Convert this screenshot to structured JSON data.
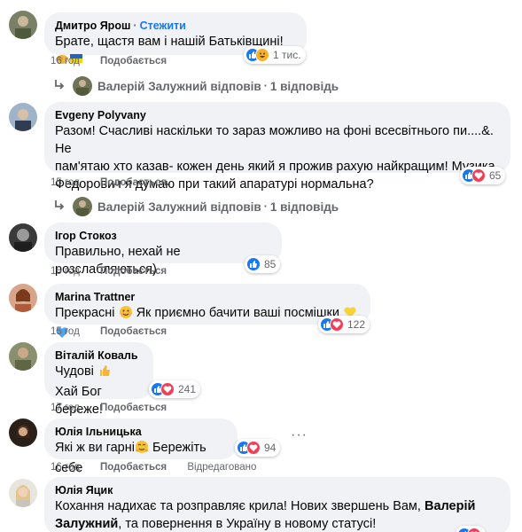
{
  "comments": [
    {
      "author": "Дмитро Ярош",
      "follow_label": "Стежити",
      "text": "Брате, щастя вам і нашій Батьківщині!",
      "time": "16 год",
      "like_label": "Подобається",
      "reaction_count": "1 тис."
    },
    {
      "reply_author": "Валерій Залужний відповів",
      "reply_count": "1 відповідь"
    },
    {
      "author": "Evgeny Polyvany",
      "text_lines": [
        "Разом! Счасливі наскільки то зараз можливо на фоні всесвітнього пи....&. Не",
        "пам'ятаю хто казав- кожен день який я прожив рахую найкращим! Музика",
        "Федорович я думаю при такий апаратурі нормальна?"
      ],
      "time": "15 год",
      "like_label": "Подобається",
      "reaction_count": "65"
    },
    {
      "reply_author": "Валерій Залужний відповів",
      "reply_count": "1 відповідь"
    },
    {
      "author": "Ігор Стокоз",
      "text": "Правильно, нехай не розслабляються)",
      "time": "15 год",
      "like_label": "Подобається",
      "reaction_count": "85"
    },
    {
      "author": "Marina Trattner",
      "text": "Прекрасні",
      "text_after": "Як приємно бачити ваші посмішки",
      "time": "15 год",
      "like_label": "Подобається",
      "reaction_count": "122"
    },
    {
      "author": "Віталій Коваль",
      "text_line1": "Чудові",
      "text_line2": "Хай Бог береже!",
      "time": "17 год",
      "like_label": "Подобається",
      "reaction_count": "241"
    },
    {
      "author": "Юлія Ільницька",
      "text": "Які ж ви гарні",
      "text_after": "Бережіть себе",
      "time": "16 год",
      "like_label": "Подобається",
      "edited_label": "Відредаговано",
      "reaction_count": "94"
    },
    {
      "author": "Юлія Яцик",
      "line1": "Кохання надихає та розправляє крила! Нових звершень Вам,",
      "line1_bold": "Валерій",
      "line2_bold": "Залужний",
      "line2": ", та повернення в Україну в новому статусі!"
    }
  ],
  "colors": {
    "bubble": "#f0f2f5",
    "meta": "#65676b",
    "link_blue": "#1877f2",
    "like_blue": "#1877f2",
    "love_red": "#f33e58"
  },
  "icons": [
    "like-icon",
    "love-icon",
    "haha-icon",
    "reply-arrow-icon",
    "more-dots-icon"
  ]
}
